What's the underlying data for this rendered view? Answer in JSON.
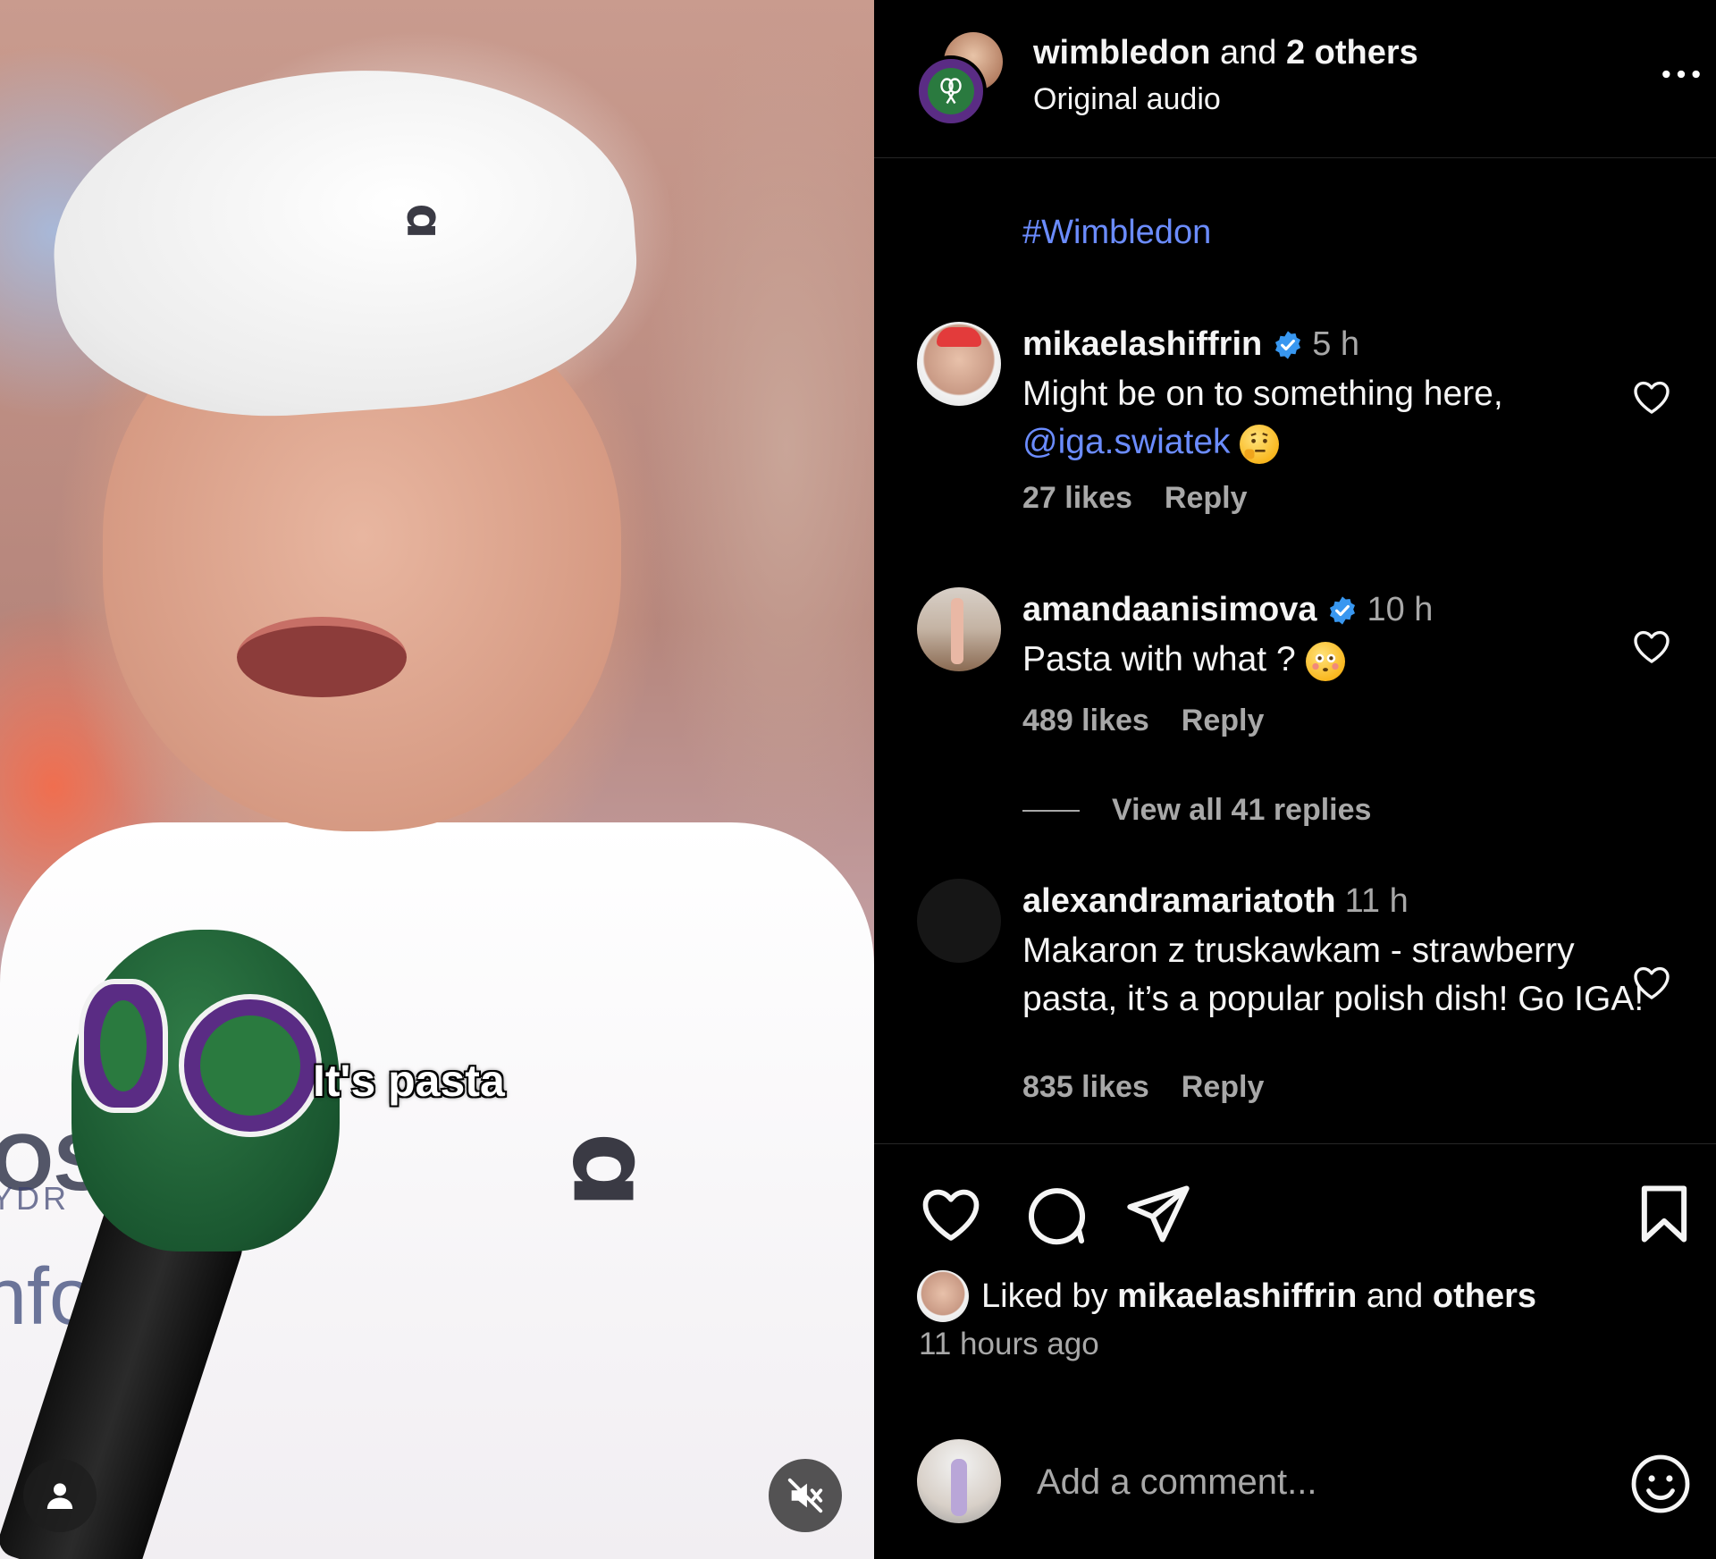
{
  "video": {
    "subtitle": "It's pasta"
  },
  "header": {
    "username": "wimbledon",
    "and_text": "and",
    "collab": "2 others",
    "audio": "Original audio"
  },
  "caption": {
    "hashtag": "#Wimbledon"
  },
  "comments": [
    {
      "username": "mikaelashiffrin",
      "verified": true,
      "time": "5 h",
      "text_line1": "Might be on to something here,",
      "mention": "@iga.swiatek",
      "likes": "27 likes",
      "reply": "Reply"
    },
    {
      "username": "amandaanisimova",
      "verified": true,
      "time": "10 h",
      "text": "Pasta with what ?",
      "likes": "489 likes",
      "reply": "Reply",
      "view_replies": "View all 41 replies"
    },
    {
      "username": "alexandramariatoth",
      "verified": false,
      "time": "11 h",
      "text": "Makaron z truskawkam - strawberry pasta, it’s a popular polish dish! Go IGA!",
      "likes": "835 likes",
      "reply": "Reply"
    }
  ],
  "footer": {
    "liked_prefix": "Liked by",
    "liked_user": "mikaelashiffrin",
    "liked_and": "and",
    "liked_others": "others",
    "time_ago": "11 hours ago",
    "comment_placeholder": "Add a comment..."
  },
  "colors": {
    "background": "#000000",
    "link": "#6b8cff",
    "verified": "#3897f0",
    "secondary_text": "#a8a8a8"
  },
  "icons": [
    "more-icon",
    "verified-icon",
    "heart-icon",
    "comment-icon",
    "share-icon",
    "bookmark-icon",
    "emoji-icon",
    "user-icon",
    "mute-icon"
  ]
}
